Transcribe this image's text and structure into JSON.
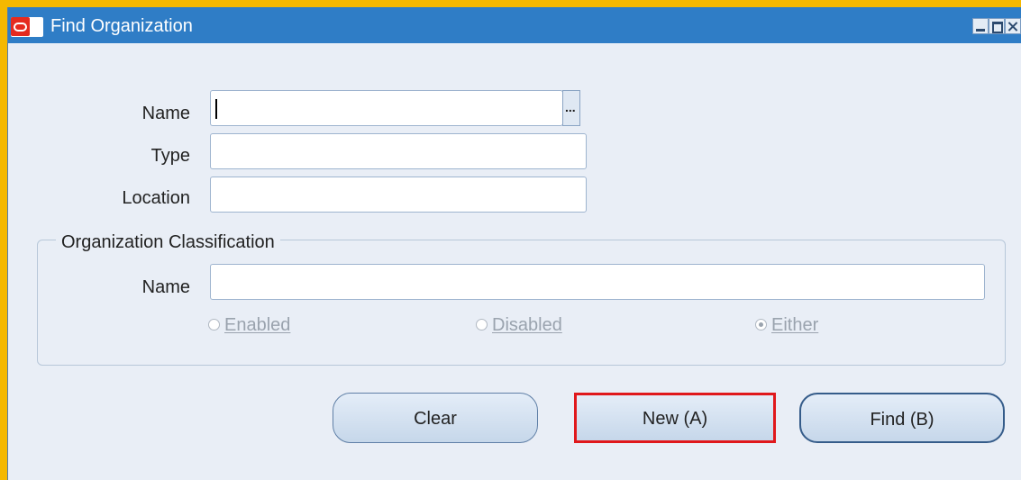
{
  "window": {
    "title": "Find Organization"
  },
  "icons": {
    "app": "oracle-icon",
    "minimize": "minimize-icon",
    "maximize": "maximize-icon",
    "close": "close-icon",
    "lov": "ellipsis-icon"
  },
  "form": {
    "name_label": "Name",
    "name_value": "",
    "type_label": "Type",
    "type_value": "",
    "location_label": "Location",
    "location_value": "",
    "lov_label": "..."
  },
  "classification": {
    "title": "Organization Classification",
    "name_label": "Name",
    "name_value": "",
    "options": [
      {
        "label": "Enabled",
        "selected": false
      },
      {
        "label": "Disabled",
        "selected": false
      },
      {
        "label": "Either",
        "selected": true
      }
    ]
  },
  "buttons": {
    "clear": "Clear",
    "new": "New (A)",
    "find": "Find (B)"
  },
  "colors": {
    "title_bar": "#2f7dc6",
    "highlight_border": "#e0181c",
    "outer_frame": "#f5b800"
  }
}
